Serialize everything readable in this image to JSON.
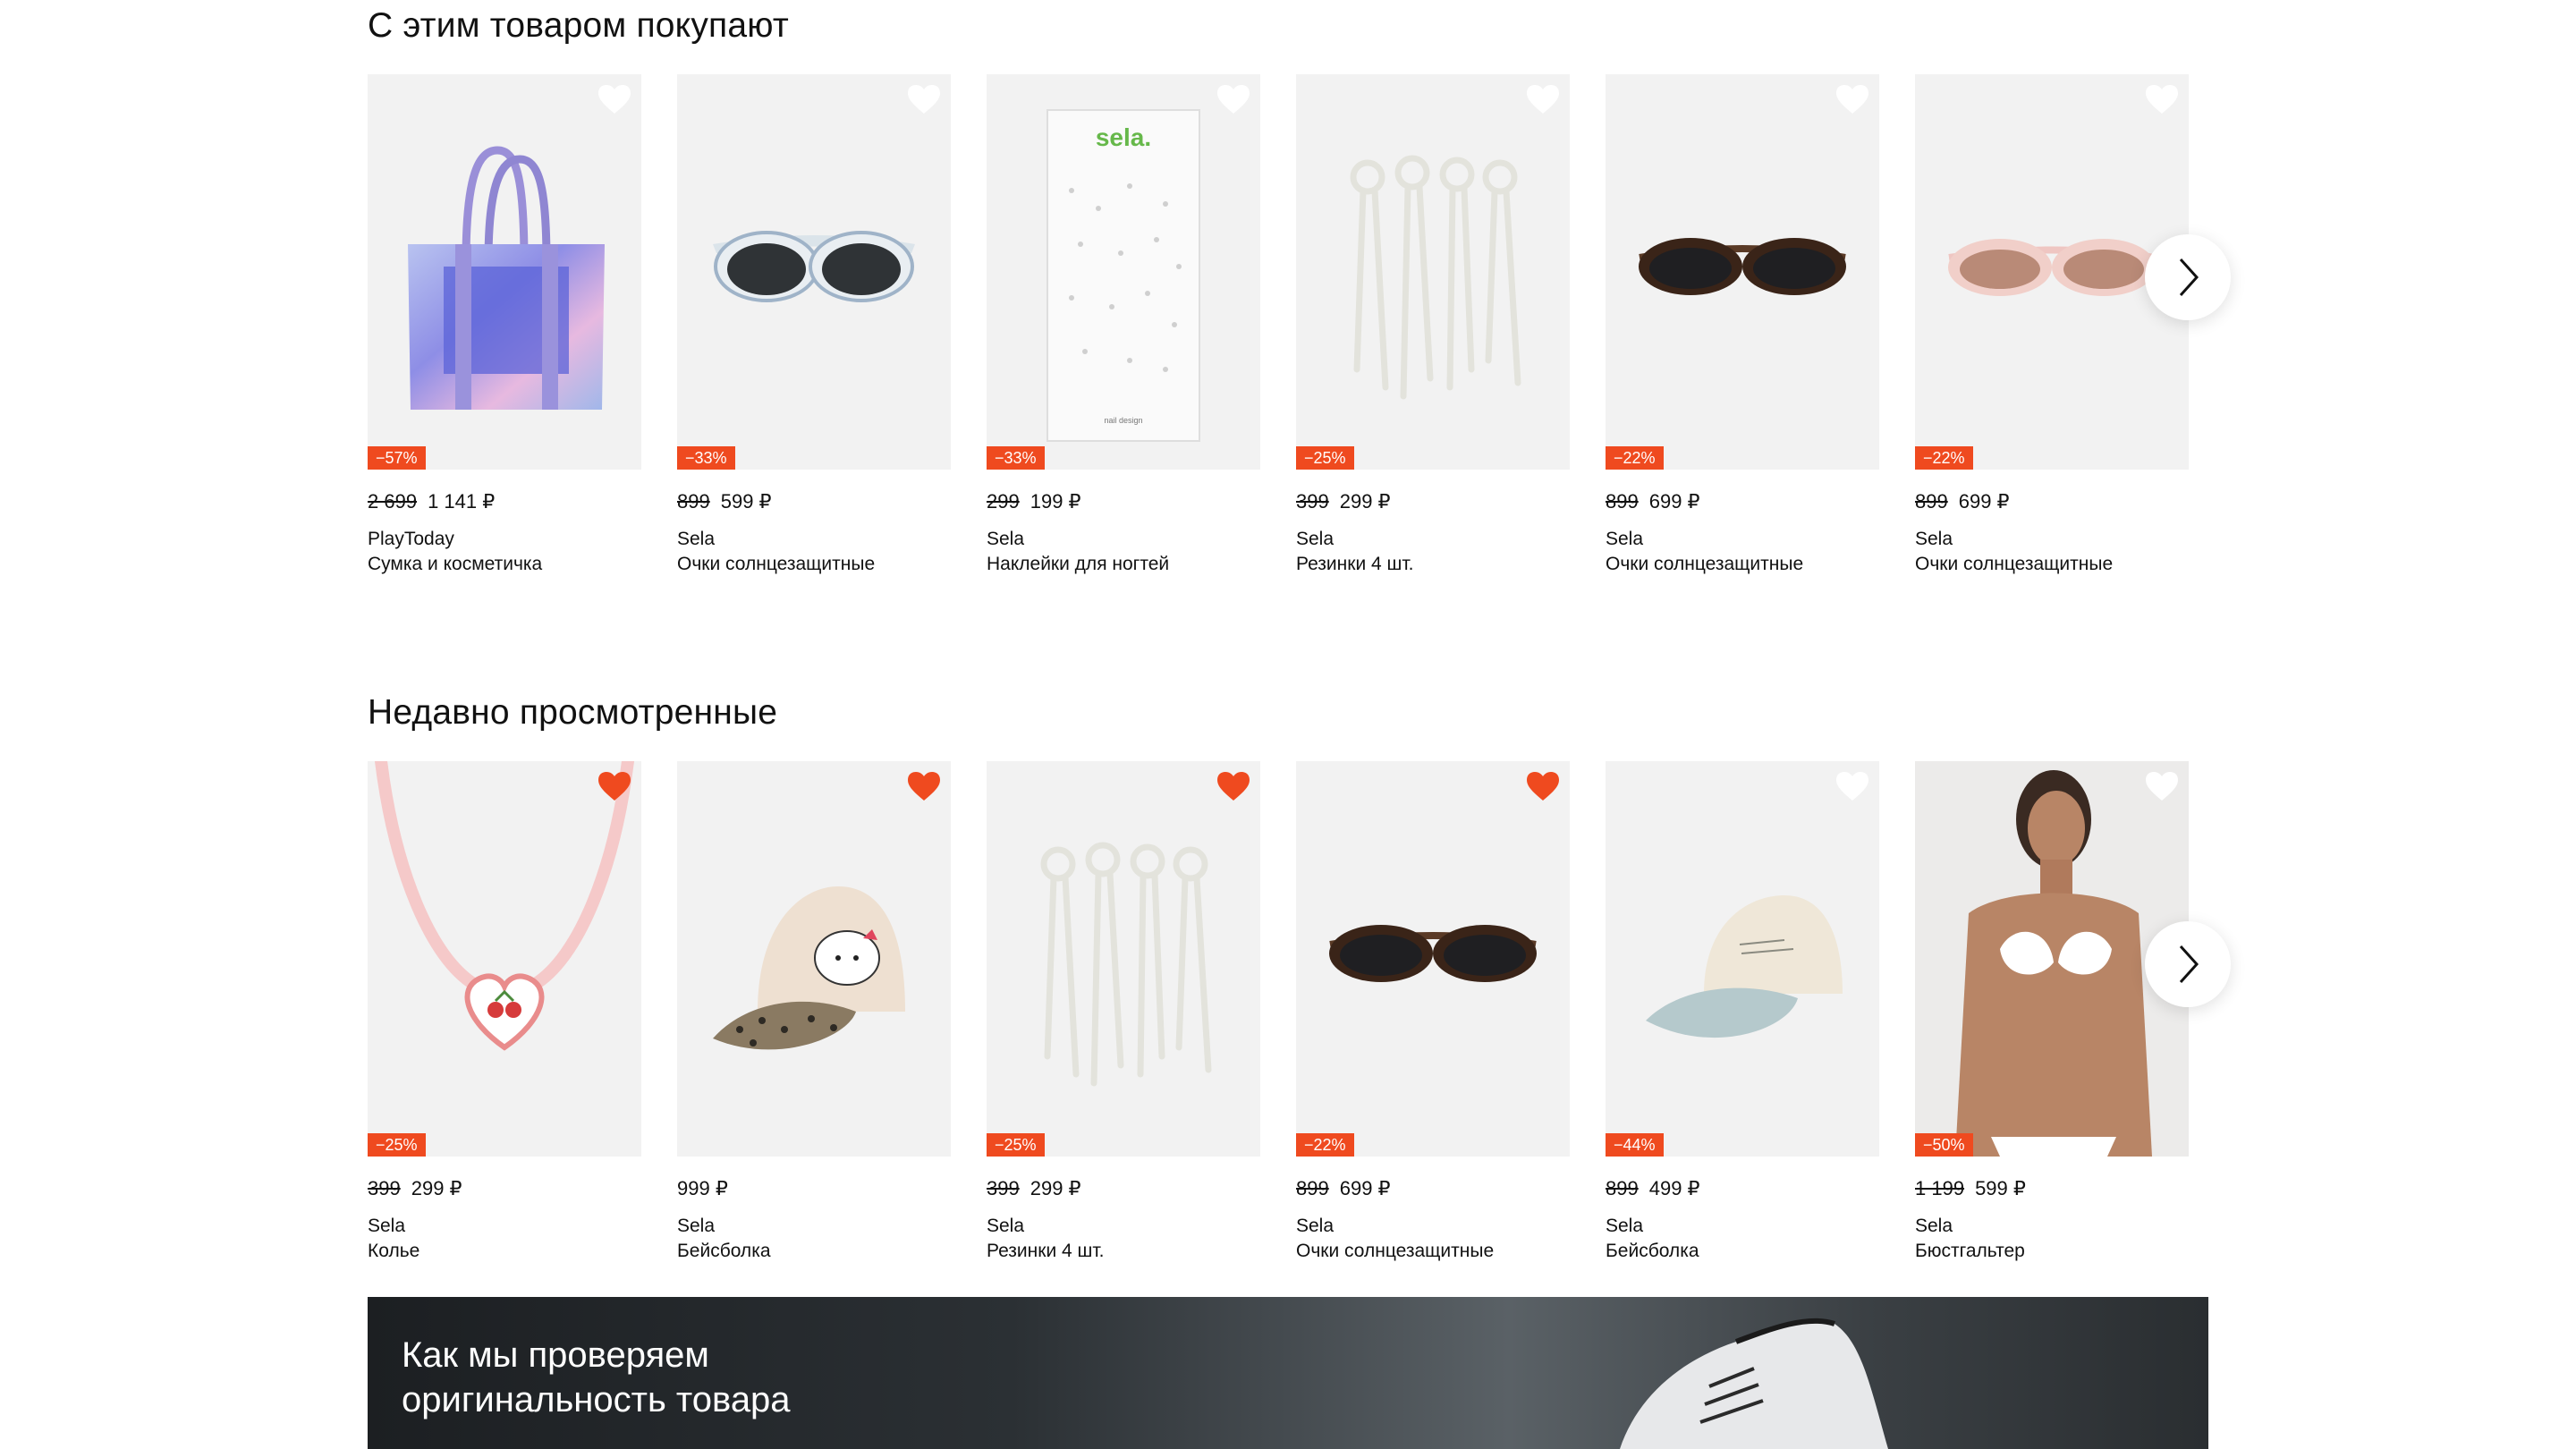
{
  "section1": {
    "title": "С этим товаром покупают",
    "products": [
      {
        "badge": "−57%",
        "old_price": "2 699",
        "price": "1 141 ₽",
        "brand": "PlayToday",
        "name": "Сумка и косметичка",
        "favorite": false,
        "image": "bag-image"
      },
      {
        "badge": "−33%",
        "old_price": "899",
        "price": "599 ₽",
        "brand": "Sela",
        "name": "Очки солнцезащитные",
        "favorite": false,
        "image": "floral-sunglasses-image"
      },
      {
        "badge": "−33%",
        "old_price": "299",
        "price": "199 ₽",
        "brand": "Sela",
        "name": "Наклейки для ногтей",
        "favorite": false,
        "image": "nail-stickers-image",
        "package_logo": "sela.",
        "package_caption": "nail design"
      },
      {
        "badge": "−25%",
        "old_price": "399",
        "price": "299 ₽",
        "brand": "Sela",
        "name": "Резинки 4 шт.",
        "favorite": false,
        "image": "hair-ties-image"
      },
      {
        "badge": "−22%",
        "old_price": "899",
        "price": "699 ₽",
        "brand": "Sela",
        "name": "Очки солнцезащитные",
        "favorite": false,
        "image": "tortoise-sunglasses-image"
      },
      {
        "badge": "−22%",
        "old_price": "899",
        "price": "699 ₽",
        "brand": "Sela",
        "name": "Очки солнцезащитные",
        "favorite": false,
        "image": "pink-sunglasses-image"
      }
    ]
  },
  "section2": {
    "title": "Недавно просмотренные",
    "products": [
      {
        "badge": "−25%",
        "old_price": "399",
        "price": "299 ₽",
        "brand": "Sela",
        "name": "Колье",
        "favorite": true,
        "image": "necklace-image"
      },
      {
        "badge": "",
        "old_price": "",
        "price": "999 ₽",
        "brand": "Sela",
        "name": "Бейсболка",
        "favorite": true,
        "image": "hello-kitty-cap-image"
      },
      {
        "badge": "−25%",
        "old_price": "399",
        "price": "299 ₽",
        "brand": "Sela",
        "name": "Резинки 4 шт.",
        "favorite": true,
        "image": "hair-ties-image"
      },
      {
        "badge": "−22%",
        "old_price": "899",
        "price": "699 ₽",
        "brand": "Sela",
        "name": "Очки солнцезащитные",
        "favorite": true,
        "image": "tortoise-sunglasses-image"
      },
      {
        "badge": "−44%",
        "old_price": "899",
        "price": "499 ₽",
        "brand": "Sela",
        "name": "Бейсболка",
        "favorite": false,
        "image": "cream-cap-image"
      },
      {
        "badge": "−50%",
        "old_price": "1 199",
        "price": "599 ₽",
        "brand": "Sela",
        "name": "Бюстгальтер",
        "favorite": false,
        "image": "bra-model-image"
      }
    ]
  },
  "banner": {
    "title_line1": "Как мы проверяем",
    "title_line2": "оригинальность товара",
    "image": "sneaker-image"
  },
  "icons": {
    "favorite": "heart-icon",
    "next": "chevron-right-icon"
  },
  "colors": {
    "badge": "#ef4a1f",
    "heart_active": "#ef4a1f",
    "heart_inactive": "#ffffff",
    "card_bg": "#f2f2f2"
  }
}
